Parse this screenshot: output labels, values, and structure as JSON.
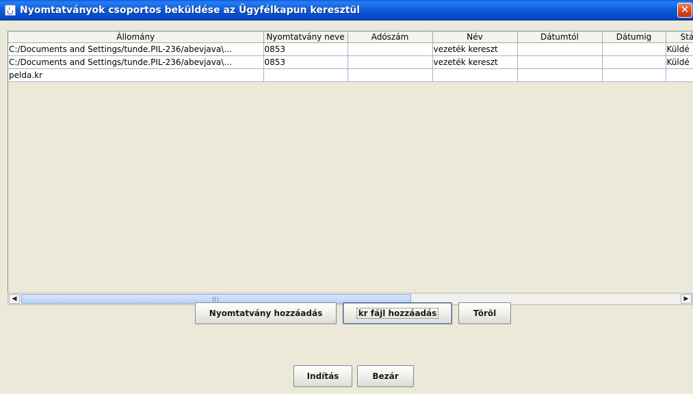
{
  "window": {
    "title": "Nyomtatványok csoportos beküldése az Ügyfélkapun keresztül",
    "close_glyph": "✕",
    "icon": "java-cup-icon"
  },
  "table": {
    "columns": [
      "Állomány",
      "Nyomtatvány neve",
      "Adószám",
      "Név",
      "Dátumtól",
      "Dátumig",
      "Stá"
    ],
    "rows": [
      [
        "C:/Documents and Settings/tunde.PIL-236/abevjava\\...",
        "0853",
        "",
        "vezeték kereszt",
        "",
        "",
        "Küldé"
      ],
      [
        "C:/Documents and Settings/tunde.PIL-236/abevjava\\...",
        "0853",
        "",
        "vezeték kereszt",
        "",
        "",
        "Küldé"
      ],
      [
        "pelda.kr",
        "",
        "",
        "",
        "",
        "",
        ""
      ]
    ]
  },
  "scrollbar": {
    "left_arrow": "◀",
    "right_arrow": "▶"
  },
  "buttons": {
    "add_form": "Nyomtatvány hozzáadás",
    "add_kr": "kr fájl hozzáadás",
    "delete": "Töröl",
    "start": "Indítás",
    "close": "Bezár"
  }
}
